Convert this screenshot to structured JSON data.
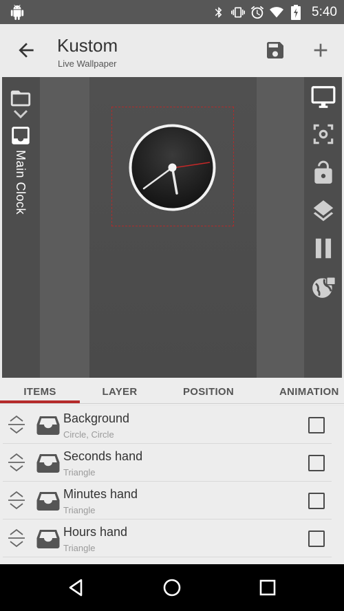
{
  "status_bar": {
    "time": "5:40",
    "icons": [
      "android-icon",
      "bluetooth-icon",
      "vibrate-icon",
      "alarm-icon",
      "wifi-icon",
      "battery-icon"
    ]
  },
  "app_bar": {
    "title": "Kustom",
    "subtitle": "Live Wallpaper",
    "icons": [
      "back-arrow-icon",
      "save-icon",
      "add-icon"
    ]
  },
  "preview": {
    "sidebar_label": "Main Clock",
    "left_icons": [
      "folder-open-icon",
      "chevron-down-icon",
      "inbox-icon"
    ],
    "right_tools": [
      "monitor-icon",
      "screenshot-icon",
      "lock-icon",
      "layers-icon",
      "pause-icon",
      "globe-lock-icon"
    ],
    "accent_color": "#b52b2b"
  },
  "tabs": [
    "ITEMS",
    "LAYER",
    "POSITION",
    "ANIMATION"
  ],
  "active_tab": "ITEMS",
  "items": [
    {
      "name": "Background",
      "type": "Circle, Circle"
    },
    {
      "name": "Seconds hand",
      "type": "Triangle"
    },
    {
      "name": "Minutes hand",
      "type": "Triangle"
    },
    {
      "name": "Hours hand",
      "type": "Triangle"
    }
  ],
  "nav_bar": {
    "icons": [
      "back-triangle-icon",
      "home-circle-icon",
      "recents-square-icon"
    ]
  }
}
